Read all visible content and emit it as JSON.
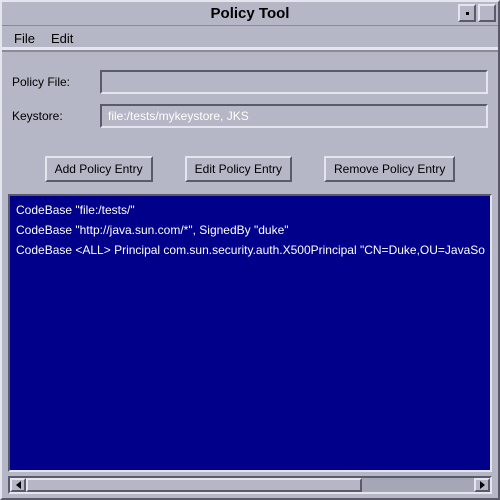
{
  "window": {
    "title": "Policy Tool"
  },
  "menu": {
    "file": "File",
    "edit": "Edit"
  },
  "form": {
    "policy_file_label": "Policy File:",
    "policy_file_value": "",
    "keystore_label": "Keystore:",
    "keystore_value": "file:/tests/mykeystore, JKS"
  },
  "buttons": {
    "add": "Add Policy Entry",
    "edit": "Edit Policy Entry",
    "remove": "Remove Policy Entry"
  },
  "entries": [
    "CodeBase \"file:/tests/\"",
    "CodeBase \"http://java.sun.com/*\", SignedBy \"duke\"",
    "CodeBase <ALL>  Principal com.sun.security.auth.X500Principal \"CN=Duke,OU=JavaSo"
  ]
}
